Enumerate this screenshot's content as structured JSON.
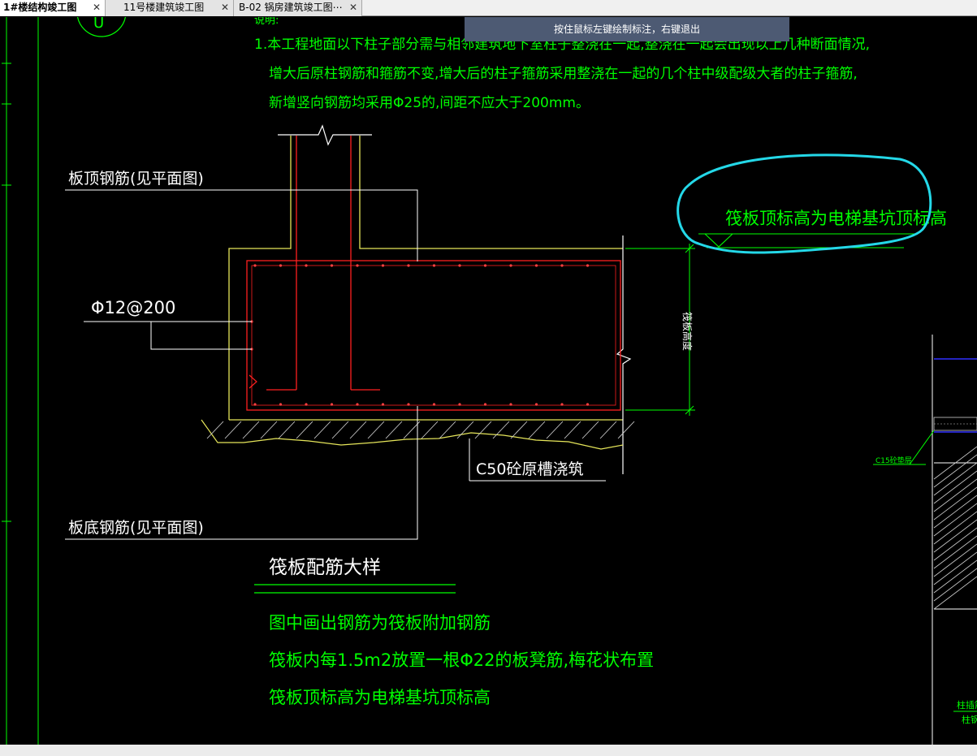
{
  "tabs": [
    {
      "label": "1#楼结构竣工图",
      "close": "✕",
      "active": true
    },
    {
      "label": "11号楼建筑竣工图",
      "close": "✕",
      "active": false
    },
    {
      "label": "B-02 锅房建筑竣工图⋯",
      "close": "✕",
      "active": false
    }
  ],
  "hint": "按住鼠标左键绘制标注，右键退出",
  "drawing": {
    "notes_top": [
      "1.本工程地面以下柱子部分需与相邻建筑地下室柱子整浇在一起,整浇在一起会出现以上几种断面情况,",
      "增大后原柱钢筋和箍筋不变,增大后的柱子箍筋采用整浇在一起的几个柱中级配级大者的柱子箍筋,",
      "新增竖向钢筋均采用Φ25的,间距不应大于200mm。"
    ],
    "label_top_rebar": "板顶钢筋(见平面图)",
    "label_stirrup": "Φ12@200",
    "label_bottom_rebar": "板底钢筋(见平面图)",
    "label_concrete": "C50砼原槽浇筑",
    "annotation_elevation": "筏板顶标高为电梯基坑顶标高",
    "label_thickness": "筏板高度",
    "section_title": "筏板配筋大样",
    "notes_bottom": [
      "图中画出钢筋为筏板附加钢筋",
      "筏板内每1.5m2放置一根Φ22的板凳筋,梅花状布置",
      "筏板顶标高为电梯基坑顶标高"
    ],
    "label_right_c15": "C15砼垫层",
    "label_right_b1": "柱插筋",
    "label_right_b2": "柱钢"
  },
  "colors": {
    "background": "#000000",
    "text_green": "#00ff00",
    "rebar_red": "#ff2020",
    "concrete_outline": "#ffff66",
    "leader_white": "#ffffff",
    "markup_cyan": "#24d8e8",
    "dim_green": "#00ff00",
    "right_blue": "#3030ff"
  }
}
